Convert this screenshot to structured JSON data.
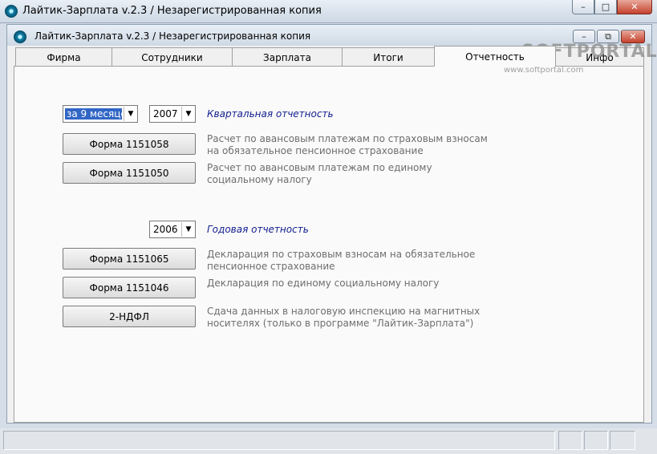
{
  "outer_window": {
    "title": "Лайтик-Зарплата v.2.3 / Незарегистрированная копия",
    "minimize": "–",
    "maximize": "□",
    "close": "✕"
  },
  "inner_window": {
    "title": "Лайтик-Зарплата v.2.3 / Незарегистрированная копия",
    "minimize": "–",
    "maximize": "⧉",
    "close": "✕"
  },
  "tabs": [
    "Фирма",
    "Сотрудники",
    "Зарплата",
    "Итоги",
    "Отчетность",
    "Инфо"
  ],
  "active_tab": "Отчетность",
  "quarterly": {
    "period_value": "за 9 месяцев",
    "year_value": "2007",
    "heading": "Квартальная отчетность",
    "items": [
      {
        "button": "Форма 1151058",
        "desc": "Расчет по авансовым платежам по страховым взносам на обязательное пенсионное страхование"
      },
      {
        "button": "Форма 1151050",
        "desc": "Расчет по авансовым платежам по единому социальному налогу"
      }
    ]
  },
  "annual": {
    "year_value": "2006",
    "heading": "Годовая отчетность",
    "items": [
      {
        "button": "Форма 1151065",
        "desc": "Декларация  по страховым взносам на обязательное пенсионное страхование"
      },
      {
        "button": "Форма 1151046",
        "desc": "Декларация по единому социальному налогу"
      },
      {
        "button": "2-НДФЛ",
        "desc": "Сдача данных в налоговую инспекцию на магнитных носителях (только в программе \"Лайтик-Зарплата\")"
      }
    ]
  },
  "watermark": {
    "brand": "SOFTPORTAL",
    "url": "www.softportal.com"
  }
}
